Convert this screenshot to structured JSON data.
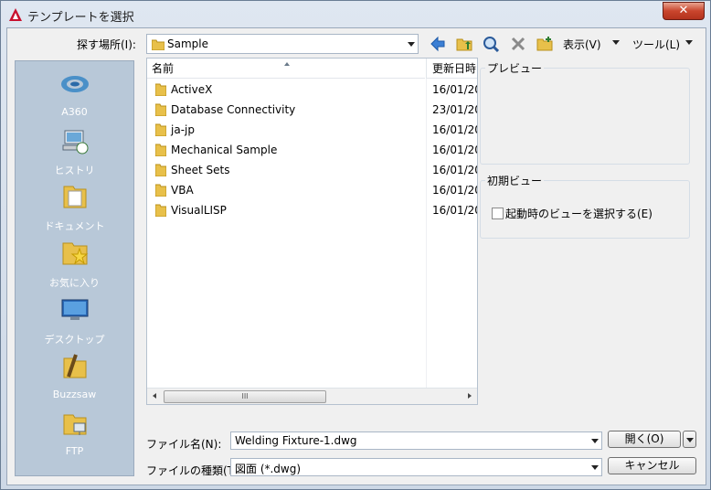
{
  "window": {
    "title": "テンプレートを選択",
    "close_glyph": "✕"
  },
  "toolbar": {
    "look_in_label": "探す場所(I):",
    "look_in_value": "Sample",
    "views_label": "表示(V)",
    "tools_label": "ツール(L)"
  },
  "places": [
    {
      "label": "A360",
      "icon": "a360-icon"
    },
    {
      "label": "ヒストリ",
      "icon": "history-icon"
    },
    {
      "label": "ドキュメント",
      "icon": "documents-icon"
    },
    {
      "label": "お気に入り",
      "icon": "favorites-icon"
    },
    {
      "label": "デスクトップ",
      "icon": "desktop-icon"
    },
    {
      "label": "Buzzsaw",
      "icon": "buzzsaw-icon"
    },
    {
      "label": "FTP",
      "icon": "ftp-icon"
    }
  ],
  "file_list": {
    "columns": {
      "name": "名前",
      "date": "更新日時"
    },
    "rows": [
      {
        "name": "ActiveX",
        "date": "16/01/20"
      },
      {
        "name": "Database Connectivity",
        "date": "23/01/20"
      },
      {
        "name": "ja-jp",
        "date": "16/01/20"
      },
      {
        "name": "Mechanical Sample",
        "date": "16/01/20"
      },
      {
        "name": "Sheet Sets",
        "date": "16/01/20"
      },
      {
        "name": "VBA",
        "date": "16/01/20"
      },
      {
        "name": "VisualLISP",
        "date": "16/01/20"
      }
    ],
    "scroll_grip": "III"
  },
  "preview": {
    "label": "プレビュー"
  },
  "initial_view": {
    "label": "初期ビュー",
    "checkbox_label": "起動時のビューを選択する(E)",
    "checked": false
  },
  "file_name": {
    "label": "ファイル名(N):",
    "value": "Welding Fixture-1.dwg"
  },
  "file_type": {
    "label": "ファイルの種類(T):",
    "value": "図面 (*.dwg)"
  },
  "buttons": {
    "open": "開く(O)",
    "cancel": "キャンセル"
  }
}
